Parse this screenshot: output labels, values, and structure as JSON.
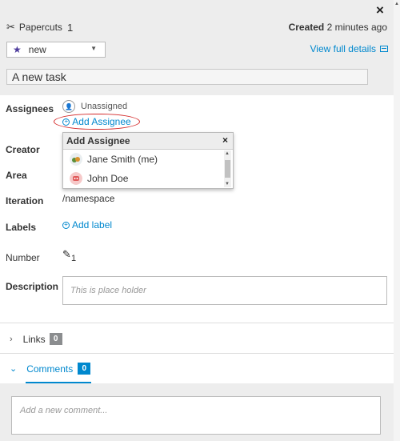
{
  "header": {
    "close_label": "×",
    "type_icon": "scissors-icon",
    "type_name": "Papercuts",
    "type_count": "1",
    "created_label": "Created",
    "created_time": "2 minutes ago",
    "state": {
      "icon": "star-icon",
      "value": "new",
      "star_color": "#4d3b9c"
    },
    "view_full_label": "View full details",
    "title_value": "A new task"
  },
  "fields": {
    "assignees_label": "Assignees",
    "unassigned_text": "Unassigned",
    "add_assignee_label": "Add Assignee",
    "creator_label": "Creator",
    "area_label": "Area",
    "iteration_label": "Iteration",
    "iteration_value": "/namespace",
    "labels_label": "Labels",
    "add_label_text": "Add label",
    "number_label": "Number",
    "number_value": "1",
    "description_label": "Description",
    "description_placeholder": "This is place holder"
  },
  "assignee_dropdown": {
    "title": "Add Assignee",
    "close_label": "×",
    "users": [
      {
        "name": "Jane Smith (me)"
      },
      {
        "name": "John Doe"
      }
    ]
  },
  "sections": {
    "links_label": "Links",
    "links_count": "0",
    "comments_label": "Comments",
    "comments_count": "0",
    "comment_placeholder": "Add a new comment..."
  },
  "colors": {
    "link": "#0088ce",
    "highlight_circle": "#d42a2a",
    "header_bg": "#ededed"
  }
}
